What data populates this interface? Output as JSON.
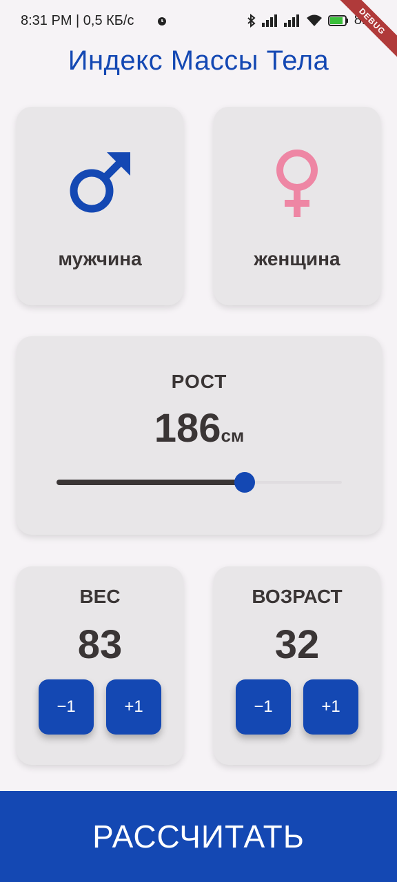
{
  "status_bar": {
    "time_speed": "8:31 PM | 0,5 КБ/с",
    "battery_pct": "81"
  },
  "debug_banner": "DEBUG",
  "app": {
    "title": "Индекс Массы Тела"
  },
  "gender": {
    "male_label": "мужчина",
    "female_label": "женщина",
    "male_color": "#1448b3",
    "female_color": "#ee86a4"
  },
  "height": {
    "label": "РОСТ",
    "value": "186",
    "unit": "см",
    "slider_fraction": 0.66
  },
  "weight": {
    "label": "ВЕС",
    "value": "83",
    "minus_label": "−1",
    "plus_label": "+1"
  },
  "age": {
    "label": "ВОЗРАСТ",
    "value": "32",
    "minus_label": "−1",
    "plus_label": "+1"
  },
  "calculate_label": "РАССЧИТАТЬ",
  "colors": {
    "accent": "#1448b3",
    "card_bg": "#e8e6e8",
    "text": "#3a3535",
    "page_bg": "#f6f3f6"
  }
}
